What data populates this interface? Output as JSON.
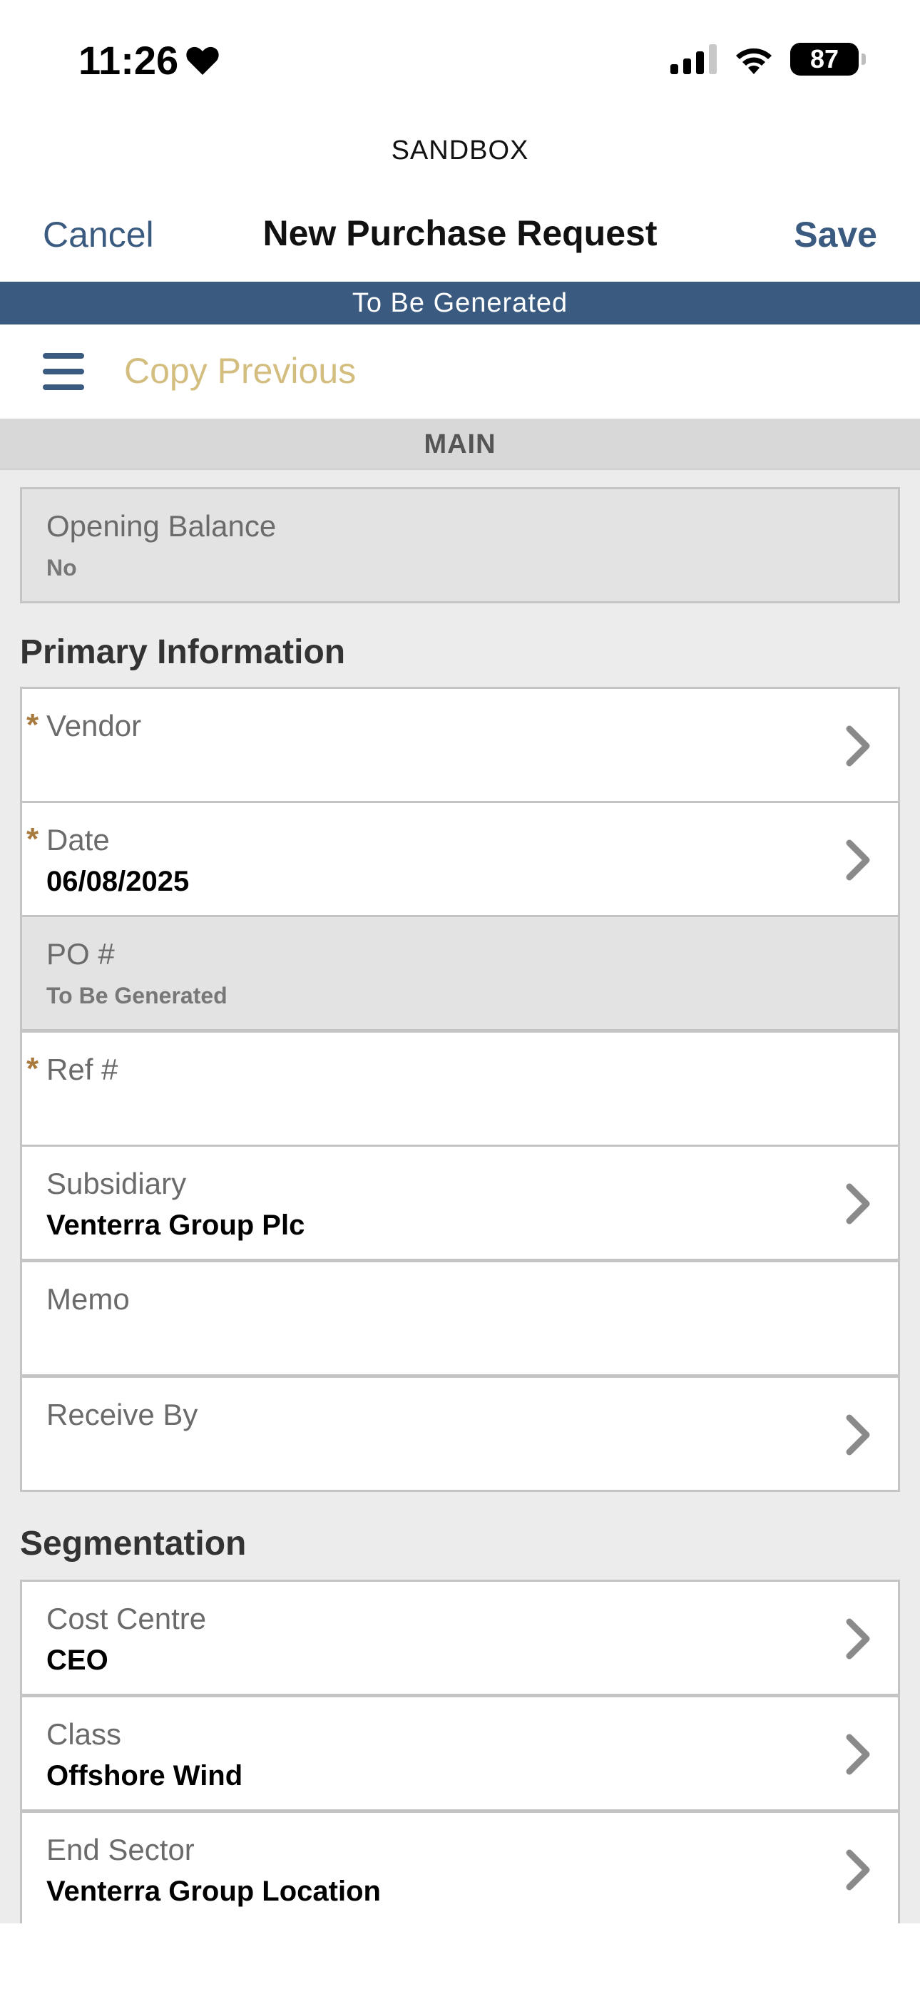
{
  "status_bar": {
    "time": "11:26",
    "battery": "87"
  },
  "environment": "SANDBOX",
  "nav": {
    "cancel": "Cancel",
    "title": "New Purchase Request",
    "save": "Save"
  },
  "banner": "To Be Generated",
  "toolbar": {
    "copy_previous": "Copy Previous"
  },
  "section_tab": "MAIN",
  "opening_balance": {
    "label": "Opening Balance",
    "value": "No"
  },
  "primary_information": {
    "heading": "Primary Information",
    "fields": [
      {
        "label": "Vendor",
        "value": ""
      },
      {
        "label": "Date",
        "value": "06/08/2025"
      },
      {
        "label": "PO #",
        "value": "To Be Generated"
      },
      {
        "label": "Ref #",
        "value": ""
      },
      {
        "label": "Subsidiary",
        "value": "Venterra Group Plc"
      },
      {
        "label": "Memo",
        "value": ""
      },
      {
        "label": "Receive By",
        "value": ""
      }
    ]
  },
  "segmentation": {
    "heading": "Segmentation",
    "fields": [
      {
        "label": "Cost Centre",
        "value": "CEO"
      },
      {
        "label": "Class",
        "value": "Offshore Wind"
      },
      {
        "label": "End Sector",
        "value": "Venterra Group Location"
      }
    ]
  },
  "required_marker": "*",
  "colors": {
    "accent": "#3a5a80",
    "copy_previous": "#d3bd7f",
    "required": "#a97a3d"
  }
}
